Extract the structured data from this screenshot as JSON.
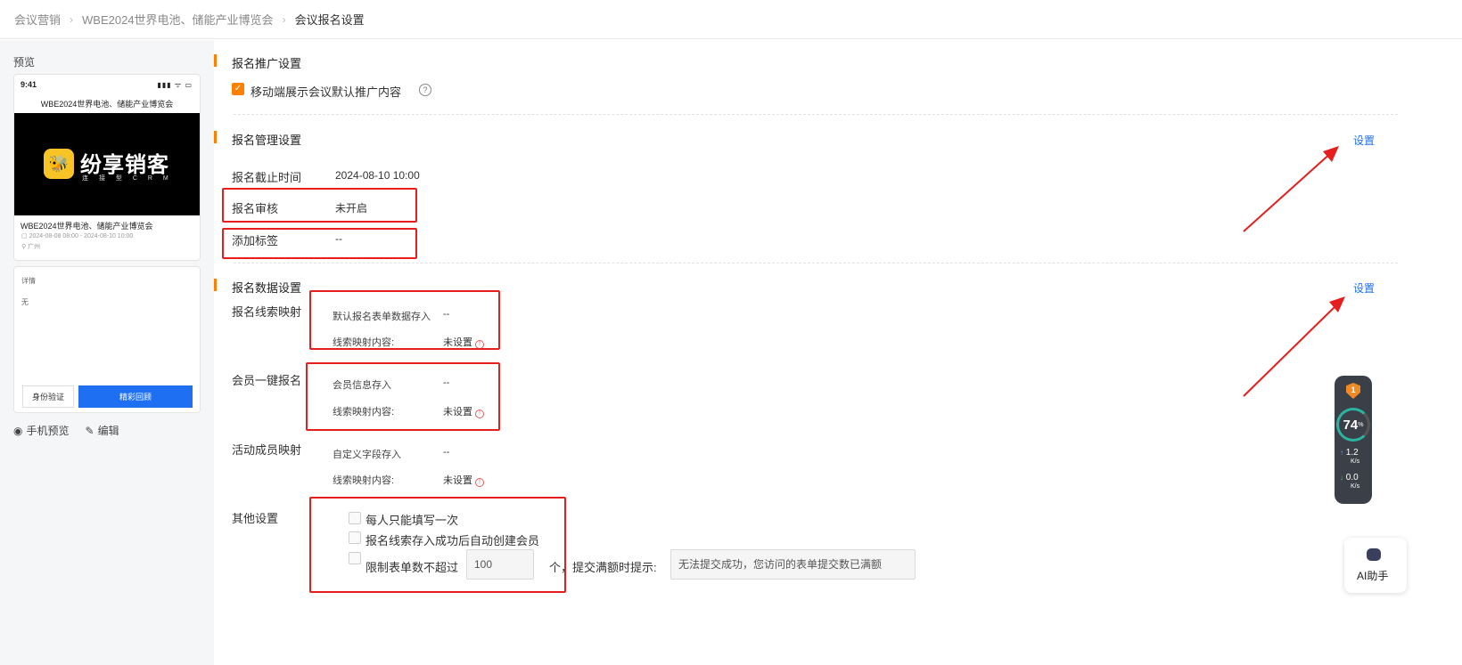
{
  "breadcrumb": [
    "会议营销",
    "WBE2024世界电池、储能产业博览会",
    "会议报名设置"
  ],
  "preview": {
    "label": "预览",
    "status_time": "9:41",
    "status_icons": "▮▮▮ ᯤ ▭",
    "phone_title": "WBE2024世界电池、储能产业博览会",
    "logo_text": "纷享销客",
    "logo_sub": "连 接 型 C R M",
    "card_title": "WBE2024世界电池、储能产业博览会",
    "card_time": "2024-08-08 08:00 - 2024-08-10 10:00",
    "card_location": "广州",
    "detail_label": "详情",
    "detail_value": "无",
    "btn_verify": "身份验证",
    "btn_replay": "精彩回顾",
    "action_preview": "手机预览",
    "action_edit": "编辑"
  },
  "promo": {
    "title": "报名推广设置",
    "checkbox_label": "移动端展示会议默认推广内容",
    "checked": true
  },
  "manage": {
    "title": "报名管理设置",
    "setting_link": "设置",
    "rows": [
      {
        "label": "报名截止时间",
        "value": "2024-08-10 10:00"
      },
      {
        "label": "报名审核",
        "value": "未开启"
      },
      {
        "label": "添加标签",
        "value": "--"
      }
    ]
  },
  "data_settings": {
    "title": "报名数据设置",
    "setting_link": "设置",
    "lead_mapping": {
      "label": "报名线索映射",
      "items": [
        {
          "label": "默认报名表单数据存入",
          "value": "--"
        },
        {
          "label": "线索映射内容:",
          "value": "未设置"
        }
      ]
    },
    "member_signup": {
      "label": "会员一键报名",
      "items": [
        {
          "label": "会员信息存入",
          "value": "--"
        },
        {
          "label": "线索映射内容:",
          "value": "未设置"
        }
      ]
    },
    "member_mapping": {
      "label": "活动成员映射",
      "items": [
        {
          "label": "自定义字段存入",
          "value": "--"
        },
        {
          "label": "线索映射内容:",
          "value": "未设置"
        }
      ]
    }
  },
  "other": {
    "label": "其他设置",
    "options": [
      "每人只能填写一次",
      "报名线索存入成功后自动创建会员",
      "限制表单数不超过"
    ],
    "limit_value": "100",
    "unit_text": "个，提交满额时提示:",
    "full_message": "无法提交成功，您访问的表单提交数已满额"
  },
  "speed_widget": {
    "badge": "1",
    "percent": "74",
    "percent_sign": "%",
    "up": "1.2",
    "down": "0.0",
    "unit": "K/s"
  },
  "ai_helper": {
    "label": "AI助手"
  },
  "colors": {
    "accent": "#ff8000",
    "link": "#1e6ff1",
    "annotation": "#e61e1e"
  }
}
